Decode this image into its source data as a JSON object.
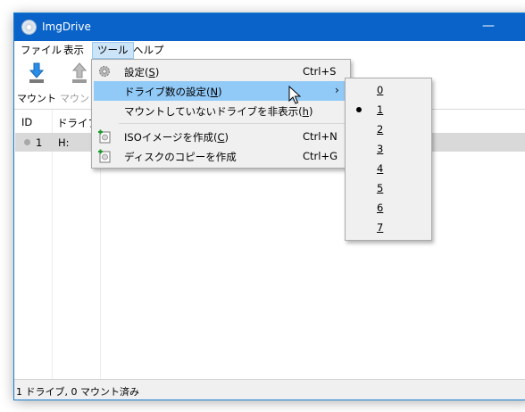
{
  "window": {
    "title": "ImgDrive",
    "minimize_glyph": "—",
    "app_icon": "disc-icon"
  },
  "menubar": [
    {
      "id": "file",
      "label": "ファイル"
    },
    {
      "id": "view",
      "label": "表示"
    },
    {
      "id": "tools",
      "label": "ツール",
      "active": true
    },
    {
      "id": "help",
      "label": "ヘルプ"
    }
  ],
  "toolbar": {
    "mount_label": "マウント",
    "unmount_label": "マウント",
    "mount_icon": "arrow-down-disc-icon",
    "unmount_icon": "arrow-up-disc-icon"
  },
  "list": {
    "columns": [
      "ID",
      "ドライブ"
    ],
    "rows": [
      {
        "id": "1",
        "drive": "H:"
      }
    ]
  },
  "tools_menu": {
    "settings": {
      "label": "設定(S)",
      "label_pre": "設定(",
      "mnemonic": "S",
      "label_post": ")",
      "shortcut": "Ctrl+S",
      "icon": "gear-icon"
    },
    "drive_count": {
      "label_pre": "ドライブ数の設定(",
      "mnemonic": "N",
      "label_post": ")",
      "arrow": "›"
    },
    "hide_unmounted": {
      "label_pre": "マウントしていないドライブを非表示(",
      "mnemonic": "h",
      "label_post": ")"
    },
    "create_iso": {
      "label_pre": "ISOイメージを作成(",
      "mnemonic": "C",
      "label_post": ")",
      "shortcut": "Ctrl+N",
      "icon": "iso-create-icon"
    },
    "copy_disc": {
      "label": "ディスクのコピーを作成",
      "shortcut": "Ctrl+G",
      "icon": "disc-copy-icon"
    }
  },
  "drive_count_submenu": {
    "options": [
      "0",
      "1",
      "2",
      "3",
      "4",
      "5",
      "6",
      "7"
    ],
    "selected": "1"
  },
  "status": {
    "text": "1 ドライブ, 0 マウント済み"
  },
  "colors": {
    "titlebar": "#0a63c9",
    "menu_highlight": "#91c9f7",
    "row_selected": "#d9d9d9"
  }
}
